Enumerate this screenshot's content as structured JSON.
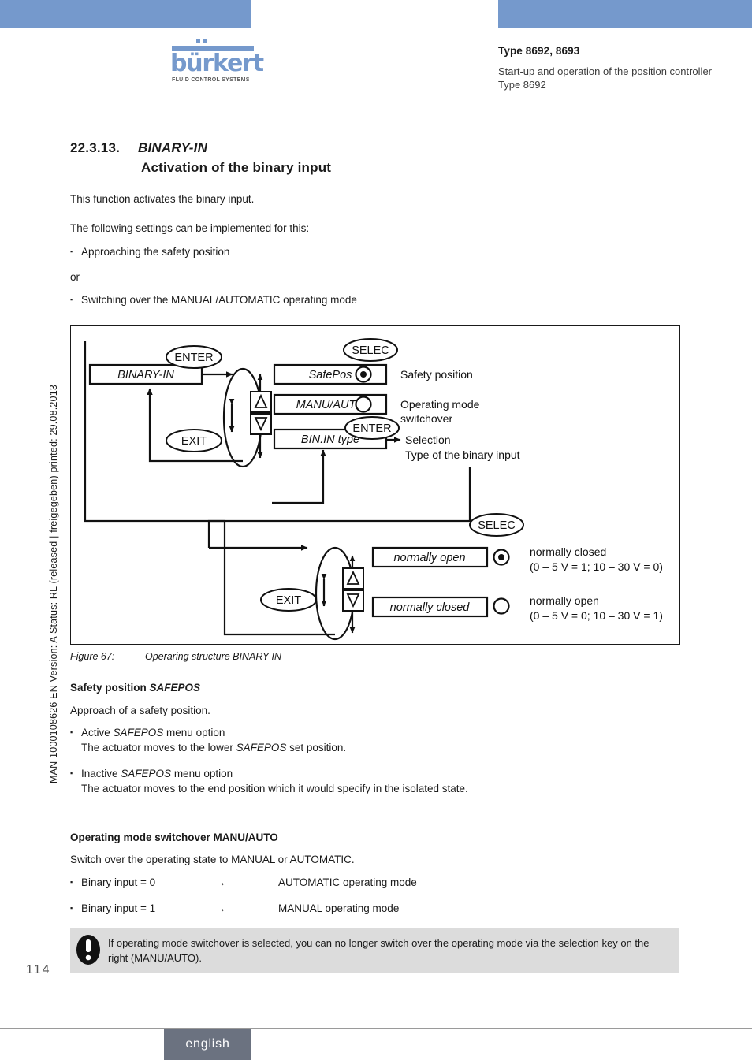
{
  "header": {
    "type_line": "Type 8692, 8693",
    "description": "Start-up and operation of the position controller Type 8692",
    "logo_word": "bürkert",
    "logo_sub": "FLUID CONTROL SYSTEMS",
    "accent_color": "#7599cc"
  },
  "margin": {
    "doc_info": "MAN 1000108626  EN  Version: A  Status: RL (released | freigegeben)  printed: 29.08.2013"
  },
  "section": {
    "number": "22.3.13.",
    "title_italic": "BINARY-IN",
    "title_second": "Activation of the binary input"
  },
  "intro": {
    "para1": "This function activates the binary input.",
    "para2": "The following settings can be implemented for this:",
    "bullet1": "Approaching the safety position",
    "conjunction": "or",
    "bullet2": "Switching over the MANUAL/AUTOMATIC operating mode"
  },
  "figure": {
    "caption_label": "Figure 67:",
    "caption_text": "Operaring structure BINARY-IN",
    "nodes": {
      "binary_in": "BINARY-IN",
      "safepos": "SafePos",
      "manu_auto": "MANU/AUTO",
      "bin_in_type": "BIN.IN type",
      "normally_open": "normally open",
      "normally_closed": "normally closed"
    },
    "keys": {
      "enter_top": "ENTER",
      "exit_top": "EXIT",
      "select_top": "SELEC",
      "enter_mid": "ENTER",
      "select_bottom": "SELEC",
      "exit_bottom": "EXIT"
    },
    "labels": {
      "safety_position": "Safety position",
      "operating_mode_1": "Operating mode",
      "operating_mode_2": "switchover",
      "selection_1": "Selection",
      "selection_2": "Type of the binary input",
      "nc_title": "normally closed",
      "nc_detail": "(0 – 5 V = 1; 10 – 30 V = 0)",
      "no_title": "normally open",
      "no_detail": "(0 – 5 V = 0; 10 – 30 V = 1)"
    }
  },
  "safepos_section": {
    "heading_plain": "Safety position ",
    "heading_italic": "SAFEPOS",
    "para": "Approach of a safety position.",
    "bullet1_line1_a": "Active ",
    "bullet1_line1_i": "SAFEPOS",
    "bullet1_line1_b": " menu option",
    "bullet1_line2_a": "The actuator moves to the lower ",
    "bullet1_line2_i": "SAFEPOS",
    "bullet1_line2_b": " set position.",
    "bullet2_line1_a": "Inactive ",
    "bullet2_line1_i": "SAFEPOS",
    "bullet2_line1_b": " menu option",
    "bullet2_line2": "The actuator moves to the end position which it would specify in the isolated state."
  },
  "manuauto_section": {
    "heading": "Operating mode switchover MANU/AUTO",
    "para": "Switch over the operating state to MANUAL or AUTOMATIC.",
    "row1_left": "Binary input = 0",
    "row1_arrow": "→",
    "row1_right": "AUTOMATIC operating mode",
    "row2_left": "Binary input = 1",
    "row2_arrow": "→",
    "row2_right": "MANUAL operating mode"
  },
  "note": {
    "text": "If operating mode switchover is selected, you can no longer switch over the operating mode via the selection key on the right (MANU/AUTO)."
  },
  "footer": {
    "page_number": "114",
    "language_tab": "english"
  }
}
